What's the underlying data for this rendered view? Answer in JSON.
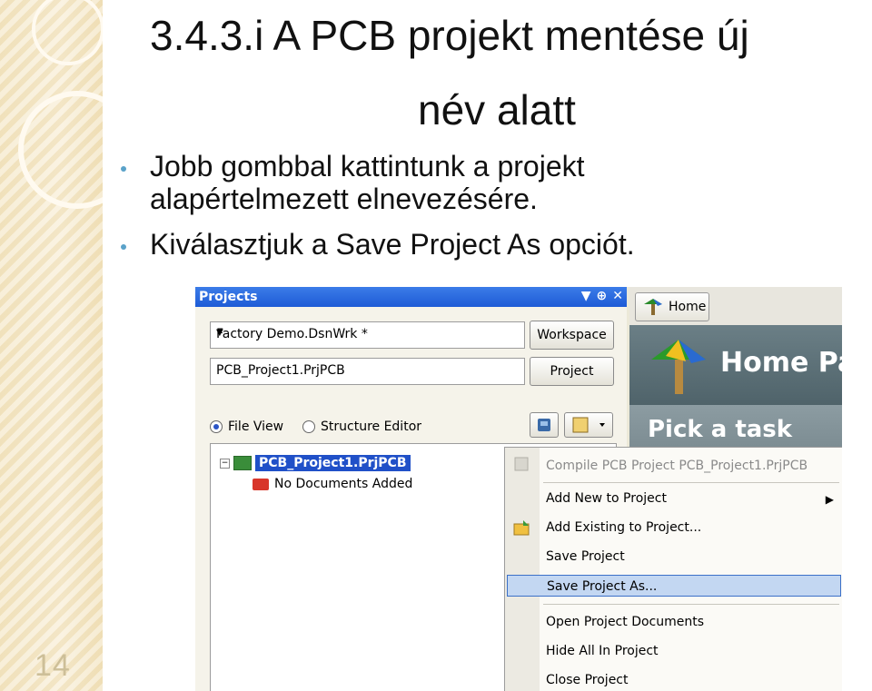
{
  "slide": {
    "title_line1": "3.4.3.i A PCB projekt mentése új",
    "title_line2": "név alatt",
    "bullets": [
      "Jobb gombbal kattintunk a projekt",
      "alapértelmezett elnevezésére.",
      "Kiválasztjuk a Save Project As opciót."
    ],
    "page_number": "14"
  },
  "screenshot": {
    "projects_panel": {
      "title": "Projects",
      "workspace_value": "Factory Demo.DsnWrk *",
      "workspace_button": "Workspace",
      "project_value": "PCB_Project1.PrjPCB",
      "project_button": "Project",
      "radio_file_view": "File View",
      "radio_structure_editor": "Structure Editor",
      "tree": {
        "project_node": "PCB_Project1.PrjPCB",
        "child_node": "No Documents Added"
      }
    },
    "home_panel": {
      "tab_label": "Home",
      "banner_text": "Home Pag",
      "pick_text": "Pick a task"
    },
    "context_menu": {
      "items": [
        {
          "label": "Compile PCB Project PCB_Project1.PrjPCB",
          "disabled": true
        },
        {
          "label": "Add New to Project",
          "submenu": true
        },
        {
          "label": "Add Existing to Project..."
        },
        {
          "label": "Save Project"
        },
        {
          "label": "Save Project As...",
          "highlighted": true
        },
        {
          "label": "Open Project Documents"
        },
        {
          "label": "Hide All In Project"
        },
        {
          "label": "Close Project"
        }
      ]
    },
    "colors": {
      "header_blue": "#1e5bd6",
      "selection_blue": "#2050c8",
      "menu_highlight": "#c3d7f2"
    }
  }
}
